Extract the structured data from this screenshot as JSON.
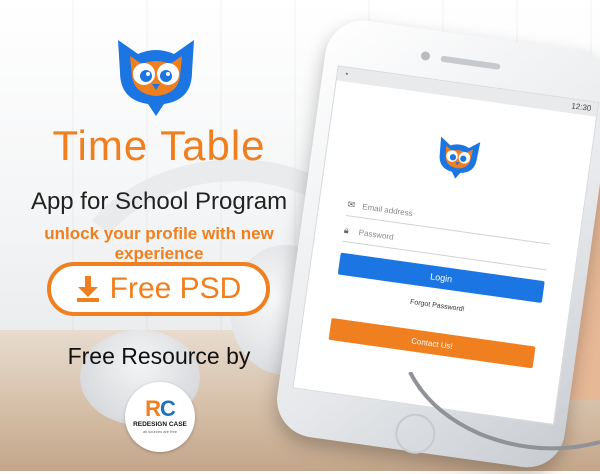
{
  "brand": {
    "title": "Time Table",
    "subtitle": "App for School Program",
    "tagline": "unlock your profile with new experience",
    "cta_label": "Free PSD",
    "resource_label": "Free Resource by",
    "logo_mark_r": "R",
    "logo_mark_c": "C",
    "logo_name": "REDESIGN CASE",
    "logo_slogan": "all sources are free"
  },
  "phone": {
    "status_time": "12:30",
    "email_placeholder": "Email address",
    "password_placeholder": "Password",
    "login_label": "Login",
    "forgot_label": "Forgot Password!",
    "contact_label": "Contact Us!"
  },
  "colors": {
    "accent_orange": "#f07f1f",
    "accent_blue": "#1b76e3"
  }
}
